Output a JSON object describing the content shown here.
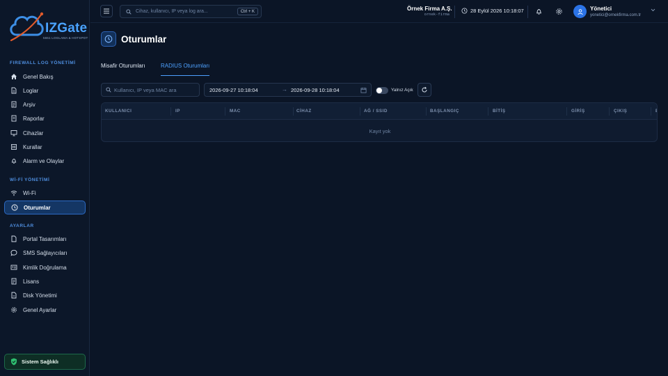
{
  "logo": {
    "brand": "IZGate",
    "tagline": "5651 LOGLAMA & HOTSPOT"
  },
  "sidebar": {
    "sections": [
      {
        "title": "FIREWALL LOG YÖNETİMİ"
      },
      {
        "title": "Wİ-Fİ YÖNETİMİ"
      },
      {
        "title": "AYARLAR"
      }
    ],
    "items": [
      {
        "label": "Genel Bakış",
        "icon": "home-icon"
      },
      {
        "label": "Loglar",
        "icon": "document-icon"
      },
      {
        "label": "Arşiv",
        "icon": "archive-icon"
      },
      {
        "label": "Raporlar",
        "icon": "report-icon"
      },
      {
        "label": "Cihazlar",
        "icon": "monitor-icon"
      },
      {
        "label": "Kurallar",
        "icon": "rules-icon"
      },
      {
        "label": "Alarm ve Olaylar",
        "icon": "bell-icon"
      },
      {
        "label": "Wi-Fi",
        "icon": "wifi-icon"
      },
      {
        "label": "Oturumlar",
        "icon": "clock-icon",
        "active": true
      },
      {
        "label": "Portal Tasarımları",
        "icon": "page-icon"
      },
      {
        "label": "SMS Sağlayıcıları",
        "icon": "chat-icon"
      },
      {
        "label": "Kimlik Doğrulama",
        "icon": "id-card-icon"
      },
      {
        "label": "Lisans",
        "icon": "license-icon"
      },
      {
        "label": "Disk Yönetimi",
        "icon": "disk-icon"
      },
      {
        "label": "Genel Ayarlar",
        "icon": "gear-icon"
      }
    ],
    "health_label": "Sistem Sağlıklı"
  },
  "header": {
    "search_placeholder": "Cihaz, kullanıcı, IP veya log ara...",
    "shortcut": "Ctrl + K",
    "company_name": "Örnek Firma A.Ş.",
    "company_code": "ornek-firma",
    "datetime": "28 Eylül 2026 10:18:07",
    "user_name": "Yönetici",
    "user_email": "yonetici@ornekfirma.com.tr"
  },
  "main": {
    "title": "Oturumlar",
    "tabs": [
      {
        "label": "Misafir Oturumları",
        "active": false
      },
      {
        "label": "RADIUS Oturumları",
        "active": true
      }
    ],
    "filter_placeholder": "Kullanıcı, IP veya MAC ara",
    "date_start": "2026-09-27 10:18:04",
    "date_arrow": "→",
    "date_end": "2026-09-28 10:18:04",
    "only_active_label": "Yalnız Açık",
    "only_active": false,
    "table": {
      "columns": [
        "KULLANICI",
        "IP",
        "MAC",
        "CİHAZ",
        "AĞ / SSID",
        "BAŞLANGIÇ",
        "BİTİŞ",
        "GİRİŞ",
        "ÇIKIŞ",
        "B"
      ],
      "empty_text": "Kayıt yok"
    }
  },
  "colors": {
    "accent": "#4ea1ff",
    "sidebar_active": "#143664",
    "health": "#1d6a4a"
  }
}
